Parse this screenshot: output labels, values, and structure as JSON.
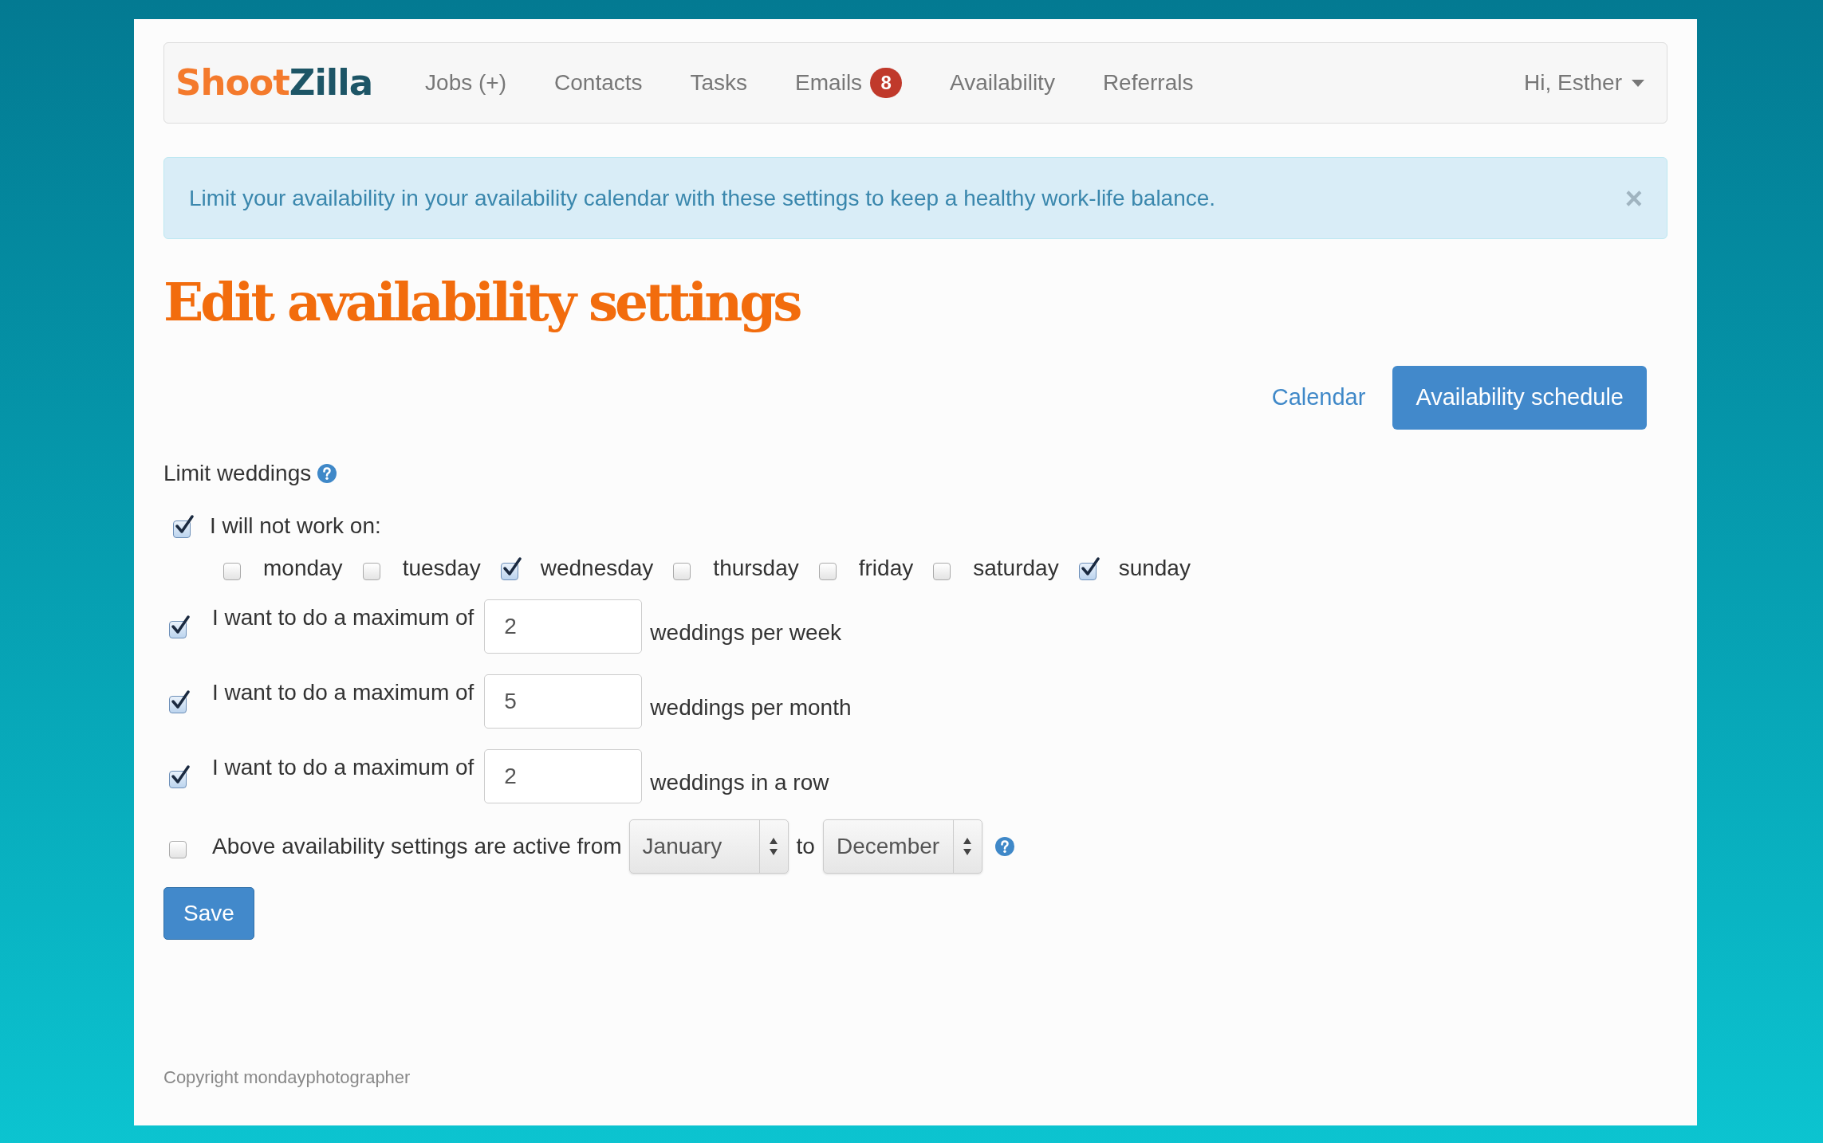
{
  "navbar": {
    "logo": [
      {
        "text": "Shoot",
        "color": "#f47a2c"
      },
      {
        "text": "Zilla",
        "color": "#1d5566"
      }
    ],
    "items": [
      {
        "label": "Jobs (+)"
      },
      {
        "label": "Contacts"
      },
      {
        "label": "Tasks"
      },
      {
        "label": "Emails",
        "badge": "8"
      },
      {
        "label": "Availability"
      },
      {
        "label": "Referrals"
      }
    ],
    "user_menu": "Hi, Esther"
  },
  "alert": {
    "text": "Limit your availability in your availability calendar with these settings to keep a healthy work-life balance.",
    "close": "×"
  },
  "page_title": "Edit availability settings",
  "actions": [
    {
      "label": "Calendar",
      "kind": "link"
    },
    {
      "label": "Availability schedule",
      "kind": "button"
    }
  ],
  "section_label": "Limit weddings",
  "rules": [
    {
      "kind": "days",
      "checked": true,
      "label": "I will not work on:",
      "days": [
        {
          "label": "monday",
          "checked": false
        },
        {
          "label": "tuesday",
          "checked": false
        },
        {
          "label": "wednesday",
          "checked": true
        },
        {
          "label": "thursday",
          "checked": false
        },
        {
          "label": "friday",
          "checked": false
        },
        {
          "label": "saturday",
          "checked": false
        },
        {
          "label": "sunday",
          "checked": true
        }
      ]
    },
    {
      "kind": "maximum",
      "checked": true,
      "label": "I want to do a maximum of",
      "value": "2",
      "suffix": "weddings per week"
    },
    {
      "kind": "maximum",
      "checked": true,
      "label": "I want to do a maximum of",
      "value": "5",
      "suffix": "weddings per month"
    },
    {
      "kind": "maximum",
      "checked": true,
      "label": "I want to do a maximum of",
      "value": "2",
      "suffix": "weddings in a row"
    },
    {
      "kind": "period",
      "checked": false,
      "label": "Above availability settings are active from",
      "from": "January",
      "joiner": "to",
      "to": "December"
    }
  ],
  "save_button": "Save",
  "footer": "Copyright mondayphotographer"
}
